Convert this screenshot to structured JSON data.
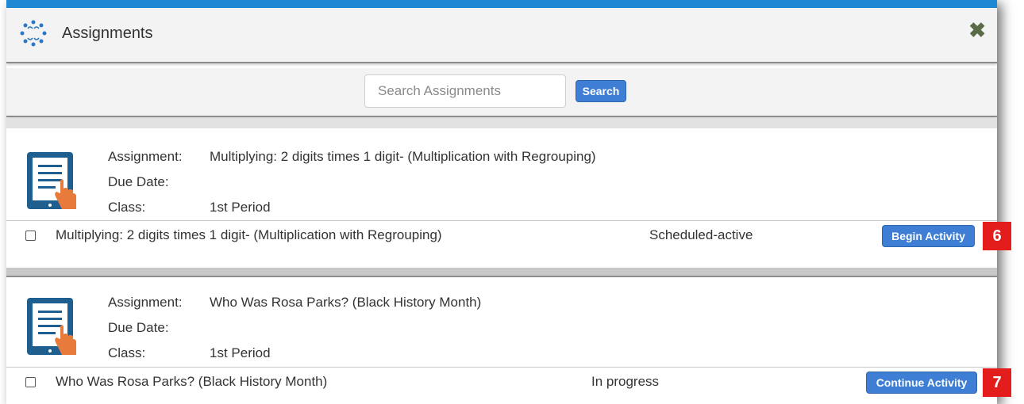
{
  "window": {
    "title": "Assignments",
    "close_icon": "close-x-icon",
    "accent_color": "#1e88d4"
  },
  "search": {
    "placeholder": "Search Assignments",
    "value": "",
    "button_label": "Search"
  },
  "labels": {
    "assignment": "Assignment:",
    "due_date": "Due Date:",
    "class": "Class:"
  },
  "assignments": [
    {
      "icon": "tablet-document-icon",
      "assignment": "Multiplying: 2 digits times 1 digit- (Multiplication with Regrouping)",
      "due_date": "",
      "class": "1st Period",
      "activity_title": "Multiplying: 2 digits times 1 digit- (Multiplication with Regrouping)",
      "status": "Scheduled-active",
      "button_label": "Begin Activity",
      "callout": "6"
    },
    {
      "icon": "tablet-document-icon",
      "assignment": "Who Was Rosa Parks? (Black History Month)",
      "due_date": "",
      "class": "1st Period",
      "activity_title": "Who Was Rosa Parks? (Black History Month)",
      "status": "In progress",
      "button_label": "Continue Activity",
      "callout": "7"
    }
  ],
  "colors": {
    "button": "#3e7ed4",
    "callout": "#e31c1c",
    "icon_frame": "#1f5f8f",
    "hand": "#e87a3c"
  }
}
